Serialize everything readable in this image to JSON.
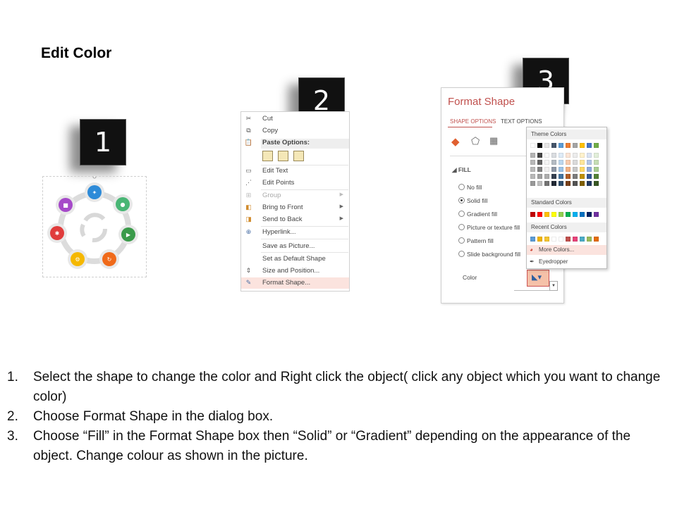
{
  "title": "Edit Color",
  "steps": [
    "1",
    "2",
    "3"
  ],
  "context_menu": {
    "items": [
      {
        "label": "Cut",
        "icon": "scissors-icon",
        "disabled": false,
        "arrow": false
      },
      {
        "label": "Copy",
        "icon": "copy-icon",
        "disabled": false,
        "arrow": false
      },
      {
        "label": "Paste Options:",
        "icon": "paste-icon",
        "disabled": false,
        "arrow": false
      },
      {
        "label": "Edit Text",
        "icon": "edit-text-icon",
        "disabled": false,
        "arrow": false
      },
      {
        "label": "Edit Points",
        "icon": "edit-points-icon",
        "disabled": false,
        "arrow": false
      },
      {
        "label": "Group",
        "icon": "group-icon",
        "disabled": true,
        "arrow": true
      },
      {
        "label": "Bring to Front",
        "icon": "bring-front-icon",
        "disabled": false,
        "arrow": true
      },
      {
        "label": "Send to Back",
        "icon": "send-back-icon",
        "disabled": false,
        "arrow": true
      },
      {
        "label": "Hyperlink...",
        "icon": "hyperlink-icon",
        "disabled": false,
        "arrow": false
      },
      {
        "label": "Save as Picture...",
        "icon": "",
        "disabled": false,
        "arrow": false
      },
      {
        "label": "Set as Default Shape",
        "icon": "",
        "disabled": false,
        "arrow": false
      },
      {
        "label": "Size and Position...",
        "icon": "size-position-icon",
        "disabled": false,
        "arrow": false
      },
      {
        "label": "Format Shape...",
        "icon": "format-shape-icon",
        "disabled": false,
        "arrow": false,
        "highlight": true
      }
    ]
  },
  "format_pane": {
    "title": "Format Shape",
    "tabs": [
      "SHAPE OPTIONS",
      "TEXT OPTIONS"
    ],
    "section": "FILL",
    "options": [
      "No fill",
      "Solid fill",
      "Gradient fill",
      "Picture or texture fill",
      "Pattern fill",
      "Slide background fill"
    ],
    "selected_option": "Solid fill",
    "color_label": "Color"
  },
  "color_picker": {
    "theme_header": "Theme Colors",
    "standard_header": "Standard Colors",
    "recent_header": "Recent Colors",
    "more_colors": "More Colors...",
    "eyedropper": "Eyedropper",
    "theme_top": [
      "#ffffff",
      "#000000",
      "#e7e6e6",
      "#44546a",
      "#5b9bd5",
      "#ed7d31",
      "#a5a5a5",
      "#ffc000",
      "#4472c4",
      "#70ad47"
    ],
    "standard": [
      "#c00000",
      "#ff0000",
      "#ffc000",
      "#ffff00",
      "#92d050",
      "#00b050",
      "#00b0f0",
      "#0070c0",
      "#002060",
      "#7030a0"
    ],
    "recent": [
      "#5b9bd5",
      "#f0b400",
      "#f4c430",
      "#ffffff",
      "#ffffff",
      "#c0504d",
      "#e8437a",
      "#4bacc6",
      "#9bbb59",
      "#e46c0a"
    ]
  },
  "instructions": [
    {
      "num": "1.",
      "text": "Select the shape to change the color and Right click the object( click any object which you want to change color)"
    },
    {
      "num": "2.",
      "text": "Choose Format Shape in the dialog box."
    },
    {
      "num": "3.",
      "text": "Choose “Fill” in the Format Shape box then “Solid” or “Gradient” depending on the appearance of the object. Change colour as shown in the picture."
    }
  ]
}
